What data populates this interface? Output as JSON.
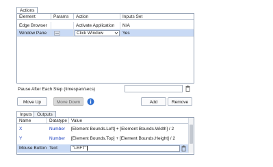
{
  "actions_tab": "Actions",
  "actions_table": {
    "headers": [
      "Element",
      "Params",
      "Action",
      "Inputs Set"
    ],
    "rows": [
      {
        "element": "Edge Browser",
        "params": "",
        "action": "Activate Application",
        "inputs_set": "N/A"
      },
      {
        "element": "Window Pane",
        "params": "params-icon",
        "action": "Click Window",
        "inputs_set": "Yes"
      }
    ]
  },
  "pause": {
    "label": "Pause After Each Step (timespan/secs)",
    "value": ""
  },
  "buttons": {
    "move_up": "Move Up",
    "move_down": "Move Down",
    "add": "Add",
    "remove": "Remove"
  },
  "io_tabs": {
    "inputs": "Inputs",
    "outputs": "Outputs"
  },
  "inputs_table": {
    "headers": [
      "Name",
      "Datatype",
      "Value"
    ],
    "rows": [
      {
        "name": "X",
        "datatype": "Number",
        "value": "[Element Bounds.Left] + [Element Bounds.Width] / 2"
      },
      {
        "name": "Y",
        "datatype": "Number",
        "value": "[Element Bounds.Top] + [Element Bounds.Height] / 2"
      },
      {
        "name": "Mouse Button",
        "datatype": "Text",
        "value": "\"LEFT\""
      }
    ]
  },
  "colors": {
    "selected_row": "#c9daf5",
    "accent_blue": "#1a3fbf",
    "info_icon": "#2f6fd0"
  }
}
